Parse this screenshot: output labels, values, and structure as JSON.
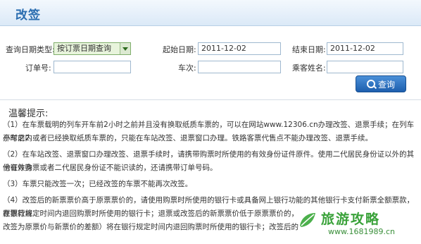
{
  "title": "改签",
  "form": {
    "query_type_label": "查询日期类型:",
    "query_type_value": "按订票日期查询",
    "start_date_label": "起始日期:",
    "start_date_value": "2011-12-02",
    "end_date_label": "结束日期:",
    "end_date_value": "2011-12-02",
    "order_no_label": "订单号:",
    "train_no_label": "车次:",
    "passenger_label": "乘客姓名:",
    "query_button": "查询"
  },
  "tips": {
    "heading": "温馨提示:",
    "p1a": "（1）在车票载明的列车开车前2小时之前并且没有换取纸质车票的，可以在网站www.12306.cn办理改签、退票手续；在列车开车前2",
    "p1b": "小时之内或者已经换取纸质车票的，只能在车站改签、退票窗口办理。铁路客票代售点不能办理改签、退票手续。",
    "p2a": "（2）在车站改签、退票窗口办理改签、退票手续时，请携带购票时所使用的有效身份证件原件。使用二代居民身份证以外的其他有效身",
    "p2b": "份证件购票或者二代居民身份证不能识读的，还请携带订单号码。",
    "p3": "（3）车票只能改签一次；已经改签的车票不能再次改签。",
    "p4a": "（4）改签后的新票票价高于原票票价的，请使用购票时所使用的银行卡或具备网上银行功能的其他银行卡支付新票全额票款，原票款将",
    "p4b": "在银行规定时间内退回购票时所使用的银行卡；退票或改签后的新票票价低于原票票价的，",
    "p4c": "改签为原票价与新票价的差额）将在银行规定时间内退回购票时所使用的银行卡；改签后的"
  },
  "watermark": {
    "brand": "旅游攻略",
    "url": "www.1681989.cn",
    "colors": {
      "brand": "#3aa23a"
    }
  },
  "colors": {
    "title": "#2a6db0",
    "button": "#1d5fae",
    "select_bg": "#e8f4dc"
  }
}
